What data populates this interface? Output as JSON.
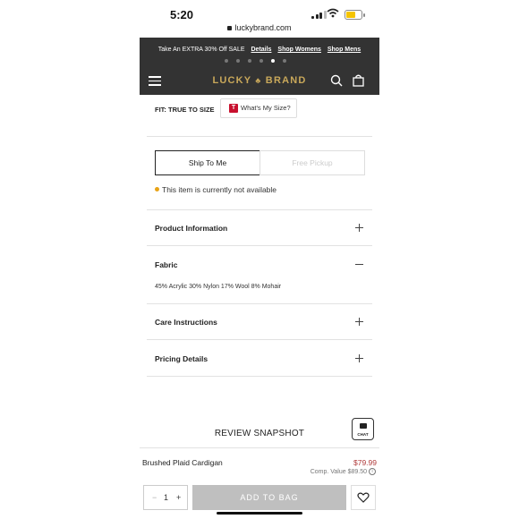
{
  "status_bar": {
    "time": "5:20",
    "url": "luckybrand.com"
  },
  "promo": {
    "text": "Take An EXTRA 30% Off SALE",
    "links": [
      "Details",
      "Shop Womens",
      "Shop Mens"
    ],
    "active_dot": 4
  },
  "nav": {
    "logo_left": "LUCKY",
    "logo_mark": "♣",
    "logo_right": "BRAND"
  },
  "fit": {
    "label": "FIT: TRUE TO SIZE",
    "size_button": "What's My Size?",
    "size_icon": "T"
  },
  "fulfillment": {
    "ship_label": "Ship To Me",
    "pickup_label": "Free Pickup",
    "availability": "This item is currently not available"
  },
  "accordions": [
    {
      "title": "Product Information",
      "expanded": false
    },
    {
      "title": "Fabric",
      "expanded": true,
      "detail": "45% Acrylic 30% Nylon 17% Wool 8% Mohair"
    },
    {
      "title": "Care Instructions",
      "expanded": false
    },
    {
      "title": "Pricing Details",
      "expanded": false
    }
  ],
  "review_heading": "REVIEW SNAPSHOT",
  "chat_label": "CHAT",
  "product": {
    "name": "Brushed Plaid Cardigan",
    "price": "$79.99",
    "comp_value": "Comp. Value $89.50"
  },
  "cart": {
    "quantity": "1",
    "minus": "−",
    "plus": "+",
    "add_to_bag": "ADD TO BAG"
  },
  "colors": {
    "header_bg": "#333333",
    "logo": "#c9a85a",
    "price": "#b03a3a",
    "availability_dot": "#e8a317",
    "button_disabled": "#bfbfbf"
  }
}
